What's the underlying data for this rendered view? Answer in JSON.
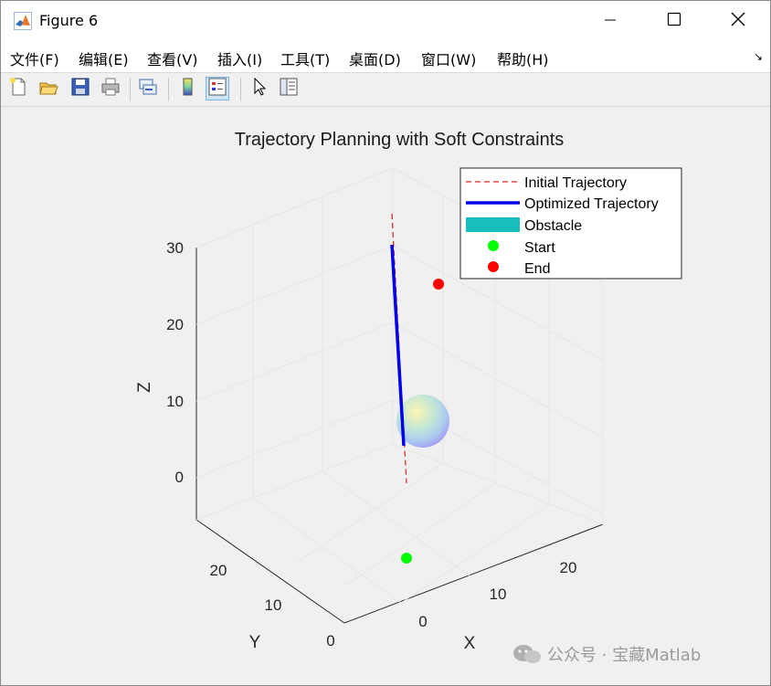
{
  "window": {
    "title": "Figure 6",
    "controls": [
      "minimize-icon",
      "maximize-icon",
      "close-icon"
    ]
  },
  "menu": {
    "items": [
      "文件(F)",
      "编辑(E)",
      "查看(V)",
      "插入(I)",
      "工具(T)",
      "桌面(D)",
      "窗口(W)",
      "帮助(H)"
    ],
    "dock_icon": "↘"
  },
  "toolbar": {
    "buttons": [
      "new-figure-icon",
      "open-file-icon",
      "save-icon",
      "print-icon",
      "link-plot-icon",
      "colorbar-icon",
      "legend-icon",
      "pointer-icon",
      "property-inspector-icon"
    ]
  },
  "chart_data": {
    "type": "line",
    "dimensions": "3d",
    "title": "Trajectory Planning with Soft Constraints",
    "xlabel": "X",
    "ylabel": "Y",
    "zlabel": "Z",
    "x_ticks": [
      "0",
      "10",
      "20"
    ],
    "y_ticks": [
      "0",
      "10",
      "20"
    ],
    "z_ticks": [
      "0",
      "10",
      "20",
      "30"
    ],
    "xlim": [
      -5,
      30
    ],
    "ylim": [
      0,
      30
    ],
    "zlim": [
      -5,
      30
    ],
    "grid": true,
    "legend_position": "top-right",
    "series": [
      {
        "name": "Initial Trajectory",
        "style": "dashed",
        "color": "#e02020",
        "points": [
          [
            0,
            0,
            -5
          ],
          [
            13,
            13,
            0
          ],
          [
            28,
            28,
            35
          ]
        ]
      },
      {
        "name": "Optimized Trajectory",
        "style": "solid",
        "color": "#0000ee",
        "points": [
          [
            13,
            13,
            2
          ],
          [
            28,
            28,
            30
          ]
        ]
      },
      {
        "name": "Obstacle",
        "style": "sphere",
        "color": "#17bebe",
        "center": [
          15,
          15,
          10
        ],
        "radius": 3
      },
      {
        "name": "Start",
        "style": "marker",
        "color": "#00ff00",
        "point": [
          0,
          0,
          0
        ]
      },
      {
        "name": "End",
        "style": "marker",
        "color": "#ff0000",
        "point": [
          30,
          30,
          30
        ]
      }
    ]
  },
  "watermark": {
    "text": "公众号 · 宝藏Matlab"
  }
}
